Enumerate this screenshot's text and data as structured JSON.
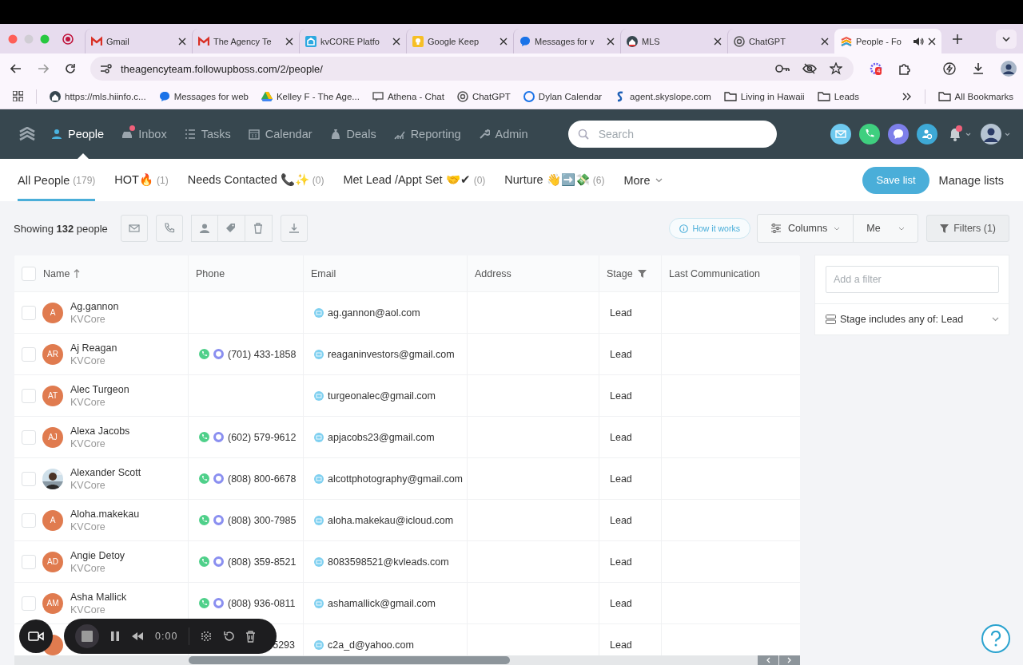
{
  "browser": {
    "tabs": [
      {
        "title": "Gmail",
        "selected": false
      },
      {
        "title": "The Agency Te",
        "selected": false
      },
      {
        "title": "kvCORE Platfo",
        "selected": false
      },
      {
        "title": "Google Keep",
        "selected": false
      },
      {
        "title": "Messages for v",
        "selected": false
      },
      {
        "title": "MLS",
        "selected": false
      },
      {
        "title": "ChatGPT",
        "selected": false
      },
      {
        "title": "People - Fo",
        "selected": true
      }
    ],
    "url": "theagencyteam.followupboss.com/2/people/",
    "extension_badge": "4",
    "bookmarks": [
      {
        "kind": "site",
        "label": "https://mls.hiinfo.c..."
      },
      {
        "kind": "site",
        "label": "Messages for web"
      },
      {
        "kind": "site",
        "label": "Kelley F - The Age..."
      },
      {
        "kind": "site",
        "label": "Athena - Chat"
      },
      {
        "kind": "site",
        "label": "ChatGPT"
      },
      {
        "kind": "site",
        "label": "Dylan Calendar"
      },
      {
        "kind": "site",
        "label": "agent.skyslope.com"
      },
      {
        "kind": "folder",
        "label": "Living in Hawaii"
      },
      {
        "kind": "folder",
        "label": "Leads"
      }
    ],
    "all_bookmarks": "All Bookmarks"
  },
  "nav": {
    "items": [
      {
        "label": "People",
        "selected": true,
        "dot": false
      },
      {
        "label": "Inbox",
        "selected": false,
        "dot": true
      },
      {
        "label": "Tasks",
        "selected": false,
        "dot": false
      },
      {
        "label": "Calendar",
        "selected": false,
        "dot": false
      },
      {
        "label": "Deals",
        "selected": false,
        "dot": false
      },
      {
        "label": "Reporting",
        "selected": false,
        "dot": false
      },
      {
        "label": "Admin",
        "selected": false,
        "dot": false
      }
    ],
    "search": {
      "placeholder": "Search"
    },
    "notifications_dot": true
  },
  "lists": {
    "tabs": [
      {
        "label": "All People",
        "count": "(179)",
        "selected": true
      },
      {
        "label": "HOT🔥",
        "count": "(1)",
        "selected": false
      },
      {
        "label": "Needs Contacted 📞✨",
        "count": "(0)",
        "selected": false
      },
      {
        "label": "Met Lead /Appt Set 🤝✔",
        "count": "(0)",
        "selected": false
      },
      {
        "label": "Nurture 👋➡️💸",
        "count": "(6)",
        "selected": false
      }
    ],
    "more": "More",
    "save": "Save list",
    "manage": "Manage lists"
  },
  "toolbar": {
    "showing": "Showing **132** people",
    "how_it_works": "How it works",
    "columns": "Columns",
    "owner": "Me",
    "filters": "Filters (1)"
  },
  "table": {
    "select_all_checked": false,
    "columns": [
      {
        "label": "Name",
        "sorted": true
      },
      {
        "label": "Phone"
      },
      {
        "label": "Email"
      },
      {
        "label": "Address"
      },
      {
        "label": "Stage",
        "filtered": true
      },
      {
        "label": "Last Communication"
      }
    ],
    "rows": [
      {
        "kind": "full",
        "checked": false,
        "photo": false,
        "initials": "A",
        "name": "Ag.gannon",
        "source": "KVCore",
        "phone": "",
        "email": "ag.gannon@aol.com",
        "stage": "Lead"
      },
      {
        "kind": "full",
        "checked": false,
        "photo": false,
        "initials": "AR",
        "name": "Aj Reagan",
        "source": "KVCore",
        "phone": "(701) 433-1858",
        "email": "reaganinvestors@gmail.com",
        "stage": "Lead"
      },
      {
        "kind": "full",
        "checked": false,
        "photo": false,
        "initials": "AT",
        "name": "Alec Turgeon",
        "source": "KVCore",
        "phone": "",
        "email": "turgeonalec@gmail.com",
        "stage": "Lead"
      },
      {
        "kind": "full",
        "checked": false,
        "photo": false,
        "initials": "AJ",
        "name": "Alexa Jacobs",
        "source": "KVCore",
        "phone": "(602) 579-9612",
        "email": "apjacobs23@gmail.com",
        "stage": "Lead"
      },
      {
        "kind": "full",
        "checked": false,
        "photo": true,
        "name": "Alexander Scott",
        "source": "KVCore",
        "phone": "(808) 800-6678",
        "email": "alcottphotography@gmail.com",
        "stage": "Lead"
      },
      {
        "kind": "full",
        "checked": false,
        "photo": false,
        "initials": "A",
        "name": "Aloha.makekau",
        "source": "KVCore",
        "phone": "(808) 300-7985",
        "email": "aloha.makekau@icloud.com",
        "stage": "Lead"
      },
      {
        "kind": "full",
        "checked": false,
        "photo": false,
        "initials": "AD",
        "name": "Angie Detoy",
        "source": "KVCore",
        "phone": "(808) 359-8521",
        "email": "8083598521@kvleads.com",
        "stage": "Lead"
      },
      {
        "kind": "full",
        "checked": false,
        "photo": false,
        "initials": "AM",
        "name": "Asha Mallick",
        "source": "KVCore",
        "phone": "(808) 936-0811",
        "email": "ashamallick@gmail.com",
        "stage": "Lead"
      },
      {
        "kind": "covered",
        "phone": "5293",
        "email": "c2a_d@yahoo.com",
        "stage": "Lead"
      }
    ]
  },
  "filters": {
    "placeholder": "Add a filter",
    "items": [
      {
        "label": "Stage includes any of: Lead",
        "expanded": false
      }
    ]
  },
  "recorder": {
    "time": "0:00"
  }
}
